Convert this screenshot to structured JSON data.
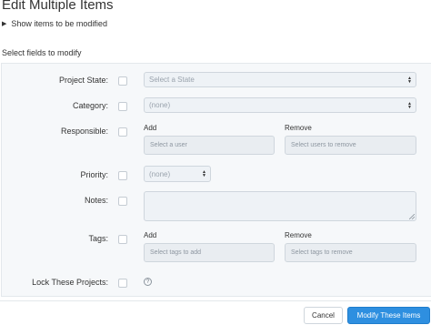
{
  "header": {
    "title": "Edit Multiple Items",
    "show_items_toggle": "Show items to be modified",
    "section_title": "Select fields to modify"
  },
  "fields": {
    "project_state": {
      "label": "Project State:",
      "placeholder": "Select a State"
    },
    "category": {
      "label": "Category:",
      "value": "(none)"
    },
    "responsible": {
      "label": "Responsible:",
      "add_label": "Add",
      "remove_label": "Remove",
      "add_placeholder": "Select a user",
      "remove_placeholder": "Select users to remove"
    },
    "priority": {
      "label": "Priority:",
      "value": "(none)"
    },
    "notes": {
      "label": "Notes:"
    },
    "tags": {
      "label": "Tags:",
      "add_label": "Add",
      "remove_label": "Remove",
      "add_placeholder": "Select tags to add",
      "remove_placeholder": "Select tags to remove"
    },
    "lock": {
      "label": "Lock These Projects:",
      "help_glyph": "?"
    }
  },
  "footer": {
    "cancel_label": "Cancel",
    "submit_label": "Modify These Items"
  },
  "colors": {
    "primary": "#2e8fe0",
    "panel_bg": "#f6f8fa",
    "field_bg": "#eef2f6"
  }
}
